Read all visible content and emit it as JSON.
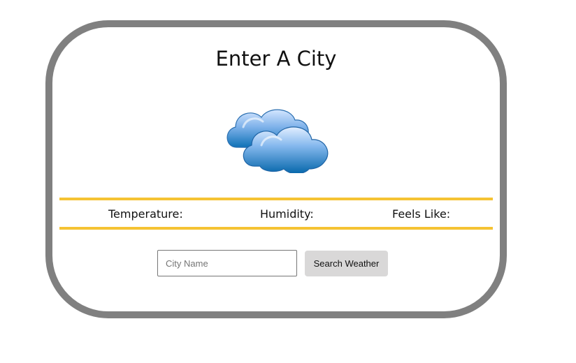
{
  "heading": "Enter A City",
  "weather_icon": "clouds-icon",
  "stats": {
    "temperature_label": "Temperature:",
    "humidity_label": "Humidity:",
    "feels_like_label": "Feels Like:"
  },
  "search": {
    "placeholder": "City Name",
    "value": "",
    "button_label": "Search Weather"
  },
  "colors": {
    "card_border": "#808080",
    "divider": "#f5c333",
    "button_bg": "#d9d8d8",
    "cloud_light": "#cfe3ff",
    "cloud_dark": "#0a6fb5"
  }
}
